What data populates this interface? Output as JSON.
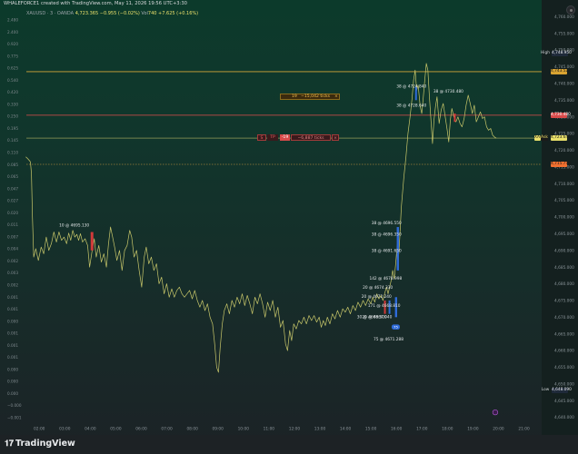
{
  "header": {
    "credit": "WHALEFORCE1 created with TradingView.com, May 11, 2026 19:56 UTC+3:30",
    "symbol": "XAUUSD · 3 · OANDA",
    "price": "4,723.365",
    "change": "−0.955 (−0.02%)",
    "vol_label": "Vol",
    "vol_value": "740",
    "vol_change": "+7.625 (+0.16%)"
  },
  "footer": {
    "logo_text": "TradingView",
    "logo_mark": "𝟏𝟕"
  },
  "colors": {
    "price_line": "#c8c76a",
    "sl": "#d4a63a",
    "tp": "#e24d4d",
    "entry": "#f0e66a",
    "bg_top": "#0c3a2b",
    "bg_bottom": "#1c2226"
  },
  "order_labels": {
    "sl": {
      "qty": "19",
      "text": "−15,042 ticks",
      "close": "×"
    },
    "tp": {
      "side": "S",
      "tp_tag": "TP",
      "qty": "-19",
      "text": "−6,887 ticks",
      "close": "×"
    }
  },
  "price_labels": [
    {
      "id": "high",
      "prefix": "High",
      "text": "4,748.950",
      "bg": "#1f2a3a",
      "fg": "#e8eaec"
    },
    {
      "id": "sl",
      "prefix": "",
      "text": "4,743.523",
      "bg": "#d9a432",
      "fg": "#1a1a1a"
    },
    {
      "id": "tp",
      "prefix": "",
      "text": "4,730.480",
      "bg": "#d84a4a",
      "fg": "#ffffff"
    },
    {
      "id": "last",
      "prefix": "XAU",
      "text": "4,723.640",
      "bg": "#e9e06a",
      "fg": "#1a1a1a",
      "code": "Ask"
    },
    {
      "id": "entry",
      "prefix": "",
      "text": "4,715.770",
      "bg": "#f07030",
      "fg": "#1a1a1a"
    },
    {
      "id": "low",
      "prefix": "Low",
      "text": "4,648.090",
      "bg": "#1f2a3a",
      "fg": "#e8eaec"
    }
  ],
  "trade_annotations": [
    {
      "text": "10 @ 4695.130"
    },
    {
      "text": "38 @ 4724.840"
    },
    {
      "text": "38 @ 4728.640"
    },
    {
      "text": "38 @ 4730.480"
    },
    {
      "text": "38 @ 4696.550"
    },
    {
      "text": "38 @ 4696.350"
    },
    {
      "text": "38 @ 4691.650"
    },
    {
      "text": "142 @ 4678.998"
    },
    {
      "text": "20 @ 4674.330"
    },
    {
      "text": "20 @ 4672.240"
    },
    {
      "text": "171 @ 4668.810"
    },
    {
      "text": "30 @ 4668.500"
    },
    {
      "text": "20 @ 4667.940"
    },
    {
      "text": "75"
    },
    {
      "text": "75 @ 4671.288"
    }
  ],
  "chart_data": {
    "type": "line",
    "title": "",
    "xlabel": "",
    "ylabel": "",
    "x_ticks": [
      "02:00",
      "03:00",
      "04:00",
      "05:00",
      "06:00",
      "07:00",
      "08:00",
      "09:00",
      "10:00",
      "11:00",
      "12:00",
      "13:00",
      "14:00",
      "15:00",
      "16:00",
      "17:00",
      "18:00",
      "19:00",
      "20:00",
      "21:00"
    ],
    "y_ticks_right": [
      "4,760.000",
      "4,755.000",
      "4,750.000",
      "4,745.000",
      "4,740.000",
      "4,735.000",
      "4,730.000",
      "4,725.000",
      "4,720.000",
      "4,715.000",
      "4,710.000",
      "4,705.000",
      "4,700.000",
      "4,695.000",
      "4,690.000",
      "4,685.000",
      "4,680.000",
      "4,675.000",
      "4,670.000",
      "4,665.000",
      "4,660.000",
      "4,655.000",
      "4,650.000",
      "4,645.000",
      "4,640.000"
    ],
    "y_ticks_left": [
      "2.480",
      "2.400",
      "0.920",
      "0.775",
      "0.625",
      "0.540",
      "0.420",
      "0.330",
      "0.250",
      "0.195",
      "0.145",
      "0.110",
      "0.085",
      "0.065",
      "0.047",
      "0.027",
      "0.020",
      "0.011",
      "0.007",
      "0.004",
      "0.002",
      "0.003",
      "0.002",
      "0.001",
      "0.001",
      "0.000",
      "0.001",
      "0.001",
      "0.001",
      "0.000",
      "0.000",
      "0.000",
      "−0.000",
      "−0.001"
    ],
    "ylim": [
      4638,
      4762
    ],
    "xlim": [
      1.5,
      21.7
    ],
    "levels": {
      "high": 4748.95,
      "sl": 4743.523,
      "tp": 4730.48,
      "last": 4723.64,
      "entry": 4715.77,
      "low": 4648.09
    },
    "series": [
      {
        "values": [
          [
            1.48,
            4718.0
          ],
          [
            1.55,
            4717.5
          ],
          [
            1.62,
            4716.9
          ],
          [
            1.66,
            4716.5
          ],
          [
            1.7,
            4713.0
          ],
          [
            1.74,
            4700.0
          ],
          [
            1.79,
            4688.0
          ],
          [
            1.87,
            4690.5
          ],
          [
            1.97,
            4687.0
          ],
          [
            2.08,
            4691.0
          ],
          [
            2.18,
            4689.0
          ],
          [
            2.28,
            4694.0
          ],
          [
            2.38,
            4690.0
          ],
          [
            2.48,
            4692.0
          ],
          [
            2.58,
            4695.5
          ],
          [
            2.68,
            4692.5
          ],
          [
            2.78,
            4695.5
          ],
          [
            2.88,
            4693.0
          ],
          [
            2.98,
            4694.0
          ],
          [
            3.08,
            4692.0
          ],
          [
            3.16,
            4695.2
          ],
          [
            3.24,
            4693.0
          ],
          [
            3.32,
            4696.0
          ],
          [
            3.4,
            4694.0
          ],
          [
            3.48,
            4694.8
          ],
          [
            3.55,
            4693.0
          ],
          [
            3.62,
            4695.0
          ],
          [
            3.7,
            4692.5
          ],
          [
            3.8,
            4693.5
          ],
          [
            3.9,
            4691.5
          ],
          [
            3.98,
            4685.0
          ],
          [
            4.08,
            4690.0
          ],
          [
            4.16,
            4693.5
          ],
          [
            4.24,
            4688.0
          ],
          [
            4.34,
            4691.5
          ],
          [
            4.44,
            4686.5
          ],
          [
            4.54,
            4689.0
          ],
          [
            4.64,
            4685.0
          ],
          [
            4.72,
            4692.0
          ],
          [
            4.8,
            4697.0
          ],
          [
            4.88,
            4694.0
          ],
          [
            4.96,
            4691.0
          ],
          [
            5.05,
            4687.0
          ],
          [
            5.15,
            4690.0
          ],
          [
            5.25,
            4684.0
          ],
          [
            5.35,
            4690.0
          ],
          [
            5.45,
            4691.5
          ],
          [
            5.55,
            4696.0
          ],
          [
            5.63,
            4694.0
          ],
          [
            5.72,
            4688.0
          ],
          [
            5.82,
            4690.0
          ],
          [
            5.92,
            4684.0
          ],
          [
            6.02,
            4679.0
          ],
          [
            6.12,
            4688.0
          ],
          [
            6.2,
            4691.0
          ],
          [
            6.3,
            4686.0
          ],
          [
            6.4,
            4688.0
          ],
          [
            6.5,
            4684.0
          ],
          [
            6.6,
            4686.0
          ],
          [
            6.7,
            4680.0
          ],
          [
            6.8,
            4682.0
          ],
          [
            6.9,
            4677.0
          ],
          [
            7.0,
            4680.0
          ],
          [
            7.1,
            4676.0
          ],
          [
            7.2,
            4678.5
          ],
          [
            7.3,
            4676.0
          ],
          [
            7.4,
            4678.0
          ],
          [
            7.5,
            4679.0
          ],
          [
            7.6,
            4677.0
          ],
          [
            7.7,
            4676.0
          ],
          [
            7.8,
            4677.0
          ],
          [
            7.9,
            4678.0
          ],
          [
            8.0,
            4675.5
          ],
          [
            8.1,
            4678.0
          ],
          [
            8.2,
            4675.0
          ],
          [
            8.3,
            4673.0
          ],
          [
            8.4,
            4675.0
          ],
          [
            8.5,
            4672.0
          ],
          [
            8.6,
            4674.0
          ],
          [
            8.7,
            4670.0
          ],
          [
            8.8,
            4668.0
          ],
          [
            8.88,
            4662.0
          ],
          [
            8.96,
            4655.0
          ],
          [
            9.03,
            4653.5
          ],
          [
            9.1,
            4661.0
          ],
          [
            9.18,
            4668.0
          ],
          [
            9.26,
            4672.0
          ],
          [
            9.36,
            4674.0
          ],
          [
            9.46,
            4671.0
          ],
          [
            9.56,
            4675.0
          ],
          [
            9.66,
            4673.0
          ],
          [
            9.76,
            4676.0
          ],
          [
            9.86,
            4674.0
          ],
          [
            9.96,
            4677.0
          ],
          [
            10.06,
            4673.5
          ],
          [
            10.16,
            4676.5
          ],
          [
            10.26,
            4674.0
          ],
          [
            10.36,
            4671.0
          ],
          [
            10.46,
            4676.0
          ],
          [
            10.56,
            4674.0
          ],
          [
            10.66,
            4677.0
          ],
          [
            10.76,
            4674.0
          ],
          [
            10.86,
            4670.0
          ],
          [
            10.96,
            4674.5
          ],
          [
            11.06,
            4672.0
          ],
          [
            11.16,
            4675.0
          ],
          [
            11.26,
            4670.0
          ],
          [
            11.36,
            4673.0
          ],
          [
            11.46,
            4667.0
          ],
          [
            11.56,
            4669.0
          ],
          [
            11.66,
            4662.0
          ],
          [
            11.74,
            4660.0
          ],
          [
            11.82,
            4666.0
          ],
          [
            11.9,
            4663.0
          ],
          [
            11.98,
            4668.0
          ],
          [
            12.08,
            4666.5
          ],
          [
            12.18,
            4669.0
          ],
          [
            12.28,
            4668.0
          ],
          [
            12.38,
            4670.0
          ],
          [
            12.48,
            4668.0
          ],
          [
            12.58,
            4670.5
          ],
          [
            12.68,
            4669.0
          ],
          [
            12.78,
            4670.5
          ],
          [
            12.88,
            4668.5
          ],
          [
            12.98,
            4670.0
          ],
          [
            13.06,
            4667.0
          ],
          [
            13.14,
            4669.0
          ],
          [
            13.22,
            4667.5
          ],
          [
            13.3,
            4670.0
          ],
          [
            13.4,
            4668.0
          ],
          [
            13.5,
            4671.0
          ],
          [
            13.6,
            4669.5
          ],
          [
            13.7,
            4672.0
          ],
          [
            13.8,
            4670.0
          ],
          [
            13.9,
            4672.5
          ],
          [
            14.0,
            4671.5
          ],
          [
            14.1,
            4673.0
          ],
          [
            14.2,
            4671.0
          ],
          [
            14.3,
            4673.5
          ],
          [
            14.4,
            4672.0
          ],
          [
            14.5,
            4674.5
          ],
          [
            14.6,
            4673.0
          ],
          [
            14.7,
            4675.0
          ],
          [
            14.8,
            4673.5
          ],
          [
            14.9,
            4675.5
          ],
          [
            15.0,
            4674.0
          ],
          [
            15.08,
            4676.0
          ],
          [
            15.16,
            4674.5
          ],
          [
            15.24,
            4677.0
          ],
          [
            15.32,
            4675.5
          ],
          [
            15.4,
            4676.5
          ],
          [
            15.48,
            4675.0
          ],
          [
            15.56,
            4677.5
          ],
          [
            15.62,
            4679.0
          ],
          [
            15.68,
            4677.0
          ],
          [
            15.74,
            4679.0
          ],
          [
            15.8,
            4681.0
          ],
          [
            15.86,
            4684.0
          ],
          [
            15.92,
            4681.5
          ],
          [
            15.98,
            4686.0
          ],
          [
            16.02,
            4690.0
          ],
          [
            16.06,
            4693.0
          ],
          [
            16.1,
            4689.0
          ],
          [
            16.14,
            4694.0
          ],
          [
            16.2,
            4703.0
          ],
          [
            16.3,
            4712.0
          ],
          [
            16.38,
            4718.0
          ],
          [
            16.46,
            4725.0
          ],
          [
            16.54,
            4730.0
          ],
          [
            16.62,
            4735.5
          ],
          [
            16.68,
            4741.0
          ],
          [
            16.74,
            4744.0
          ],
          [
            16.8,
            4738.0
          ],
          [
            16.86,
            4739.5
          ],
          [
            16.94,
            4733.0
          ],
          [
            17.0,
            4731.0
          ],
          [
            17.06,
            4736.0
          ],
          [
            17.12,
            4741.0
          ],
          [
            17.18,
            4746.0
          ],
          [
            17.24,
            4744.0
          ],
          [
            17.3,
            4736.0
          ],
          [
            17.36,
            4729.0
          ],
          [
            17.42,
            4722.0
          ],
          [
            17.48,
            4729.0
          ],
          [
            17.54,
            4733.0
          ],
          [
            17.6,
            4736.0
          ],
          [
            17.68,
            4728.0
          ],
          [
            17.76,
            4732.0
          ],
          [
            17.84,
            4734.0
          ],
          [
            17.92,
            4730.0
          ],
          [
            18.0,
            4726.0
          ],
          [
            18.06,
            4722.5
          ],
          [
            18.12,
            4729.0
          ],
          [
            18.18,
            4732.5
          ],
          [
            18.26,
            4730.0
          ],
          [
            18.34,
            4728.5
          ],
          [
            18.42,
            4730.0
          ],
          [
            18.5,
            4728.0
          ],
          [
            18.58,
            4727.0
          ],
          [
            18.66,
            4729.5
          ],
          [
            18.74,
            4733.5
          ],
          [
            18.82,
            4736.5
          ],
          [
            18.9,
            4734.0
          ],
          [
            18.98,
            4731.0
          ],
          [
            19.06,
            4733.5
          ],
          [
            19.14,
            4728.5
          ],
          [
            19.22,
            4730.0
          ],
          [
            19.3,
            4731.5
          ],
          [
            19.38,
            4729.5
          ],
          [
            19.46,
            4730.0
          ],
          [
            19.54,
            4727.0
          ],
          [
            19.62,
            4726.0
          ],
          [
            19.7,
            4726.5
          ],
          [
            19.78,
            4724.5
          ],
          [
            19.86,
            4723.9
          ],
          [
            19.92,
            4723.6
          ]
        ]
      }
    ]
  }
}
